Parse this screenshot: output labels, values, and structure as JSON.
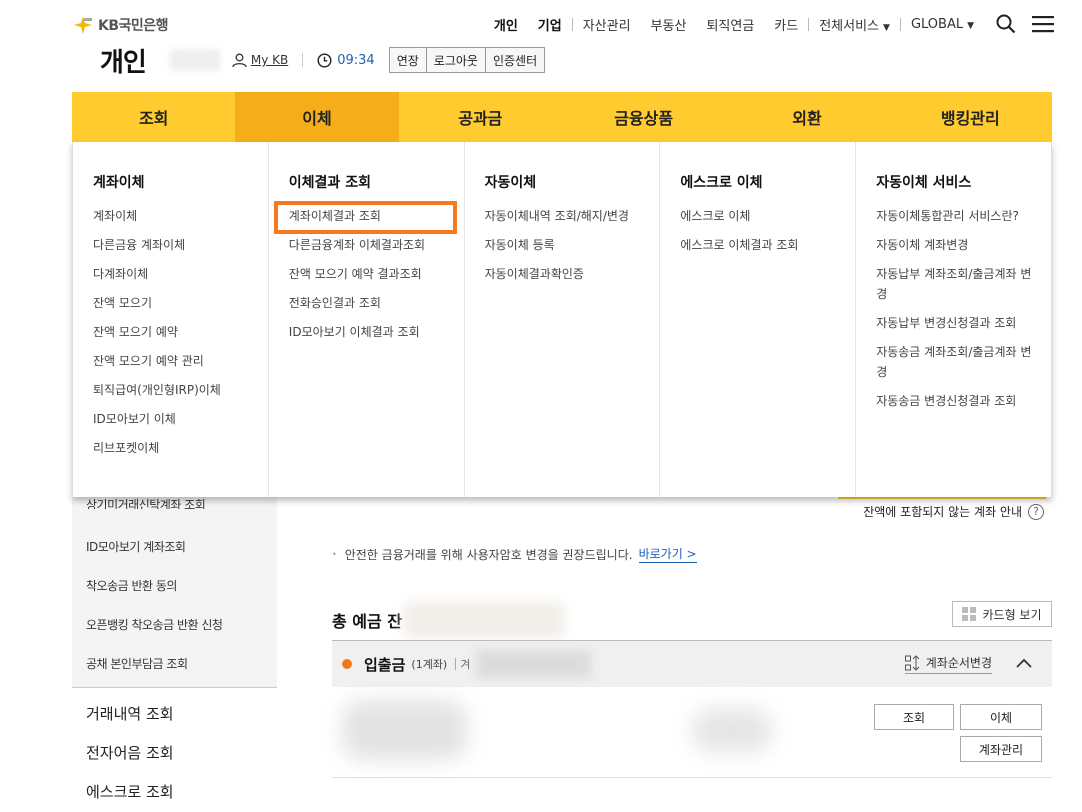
{
  "brand": {
    "logo_text": "KB국민은행"
  },
  "topnav": {
    "items": [
      "개인",
      "기업",
      "자산관리",
      "부동산",
      "퇴직연금",
      "카드",
      "전체서비스",
      "GLOBAL"
    ]
  },
  "subheader": {
    "title": "개인",
    "mykb": "My KB",
    "timer": "09:34",
    "buttons": [
      "연장",
      "로그아웃",
      "인증센터"
    ]
  },
  "gnb": {
    "items": [
      "조회",
      "이체",
      "공과금",
      "금융상품",
      "외환",
      "뱅킹관리"
    ],
    "active_index": 1
  },
  "mega": {
    "columns": [
      {
        "title": "계좌이체",
        "items": [
          "계좌이체",
          "다른금융 계좌이체",
          "다계좌이체",
          "잔액 모으기",
          "잔액 모으기 예약",
          "잔액 모으기 예약 관리",
          "퇴직급여(개인형IRP)이체",
          "ID모아보기 이체",
          "리브포켓이체"
        ]
      },
      {
        "title": "이체결과 조회",
        "items": [
          "계좌이체결과 조회",
          "다른금융계좌 이체결과조회",
          "잔액 모으기 예약 결과조회",
          "전화승인결과 조회",
          "ID모아보기 이체결과 조회"
        ]
      },
      {
        "title": "자동이체",
        "items": [
          "자동이체내역 조회/해지/변경",
          "자동이체 등록",
          "자동이체결과확인증"
        ]
      },
      {
        "title": "에스크로 이체",
        "items": [
          "에스크로 이체",
          "에스크로 이체결과 조회"
        ]
      },
      {
        "title": "자동이체 서비스",
        "items": [
          "자동이체통합관리 서비스란?",
          "자동이체 계좌변경",
          "자동납부 계좌조회/출금계좌 변경",
          "자동납부 변경신청결과 조회",
          "자동송금 계좌조회/출금계좌 변경",
          "자동송금 변경신청결과 조회"
        ]
      }
    ]
  },
  "leftnav": {
    "sub_items": [
      "상기미거래신탁계좌 조회",
      "ID모아보기 계좌조회",
      "착오송금 반환 동의",
      "오픈뱅킹 착오송금 반환 신청",
      "공채 본인부담금 조회"
    ],
    "main_items": [
      "거래내역 조회",
      "전자어음 조회",
      "에스크로 조회"
    ]
  },
  "content": {
    "balance_notice": "잔액에 포함되지 않는 계좌 안내",
    "help_icon_text": "?",
    "pw_notice": "안전한 금융거래를 위해 사용자암호 변경을 권장드립니다.",
    "pw_link": "바로가기 >",
    "total_label": "총 예금 잔",
    "card_view": "카드형 보기",
    "account_group": "입출금",
    "account_count": "(1계좌)",
    "account_prefix": "겨",
    "reorder": "계좌순서변경",
    "row_buttons": {
      "inquiry": "조회",
      "transfer": "이체",
      "manage": "계좌관리"
    }
  },
  "colors": {
    "accent": "#ffcb2f",
    "active_tab": "#f5ae1a",
    "highlight": "#f57a1f",
    "link": "#1f5fb5"
  }
}
